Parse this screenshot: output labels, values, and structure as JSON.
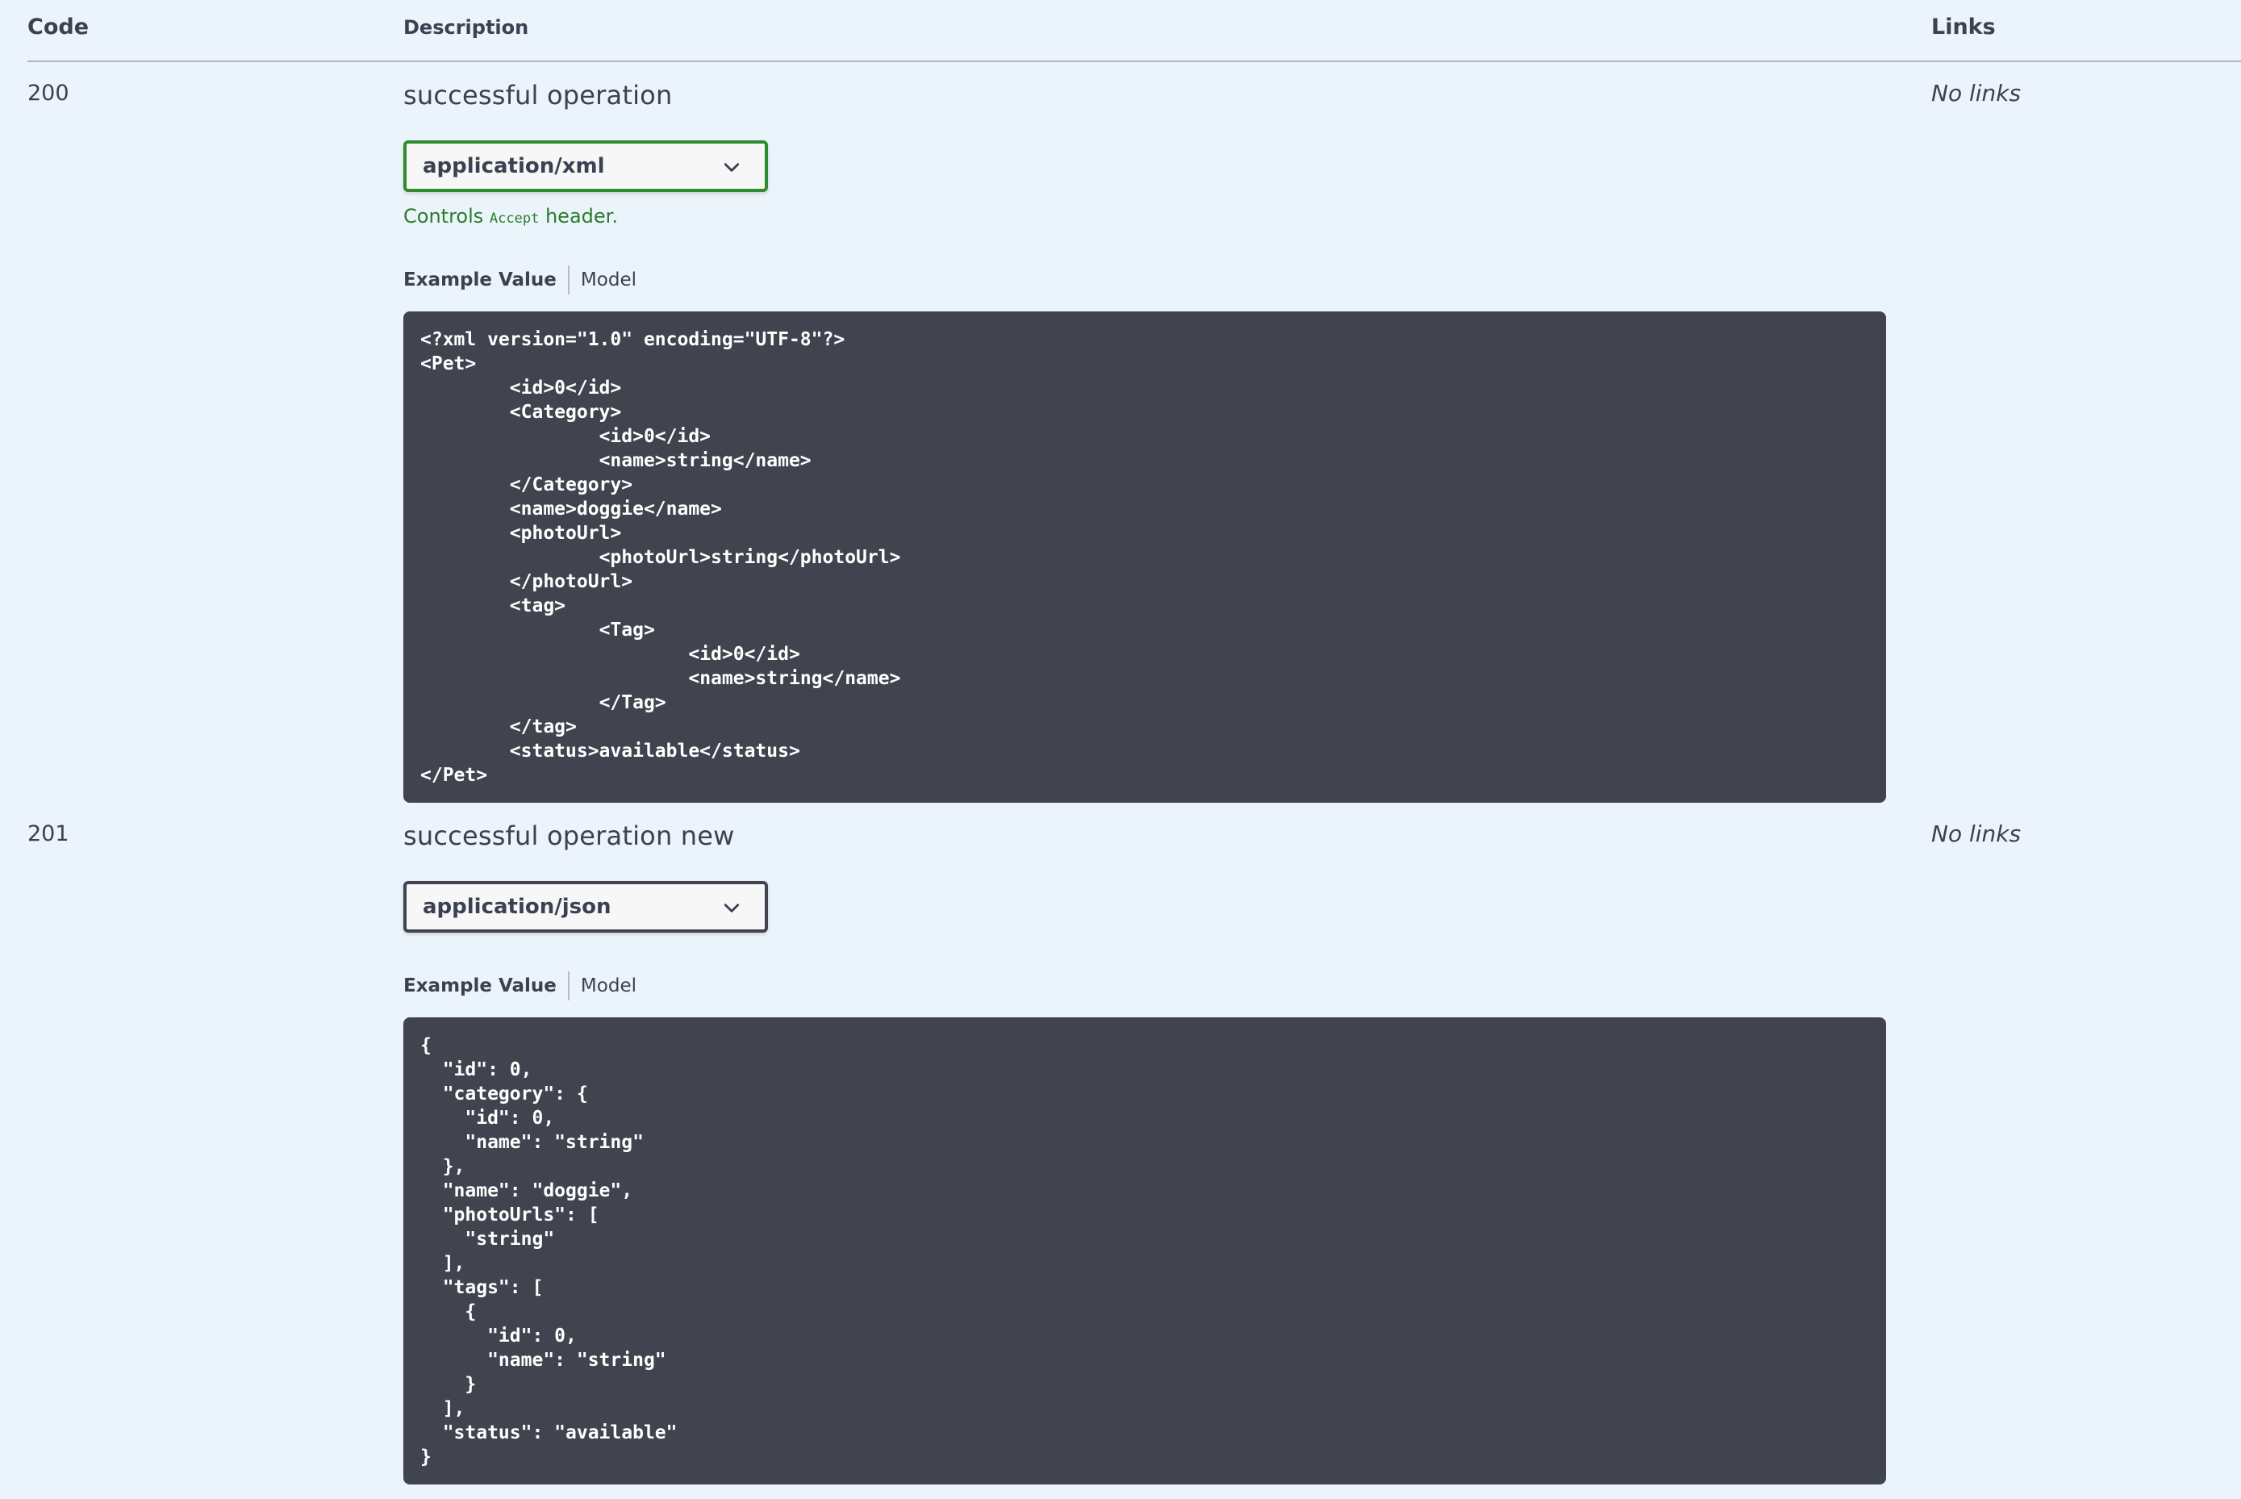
{
  "header": {
    "code": "Code",
    "description": "Description",
    "links": "Links"
  },
  "responses": [
    {
      "code": "200",
      "description": "successful operation",
      "links": "No links",
      "media_type": "application/xml",
      "controls_prefix": "Controls",
      "controls_code": "Accept",
      "controls_suffix": "header.",
      "tab_example": "Example Value",
      "tab_model": "Model",
      "example": "<?xml version=\"1.0\" encoding=\"UTF-8\"?>\n<Pet>\n\t<id>0</id>\n\t<Category>\n\t\t<id>0</id>\n\t\t<name>string</name>\n\t</Category>\n\t<name>doggie</name>\n\t<photoUrl>\n\t\t<photoUrl>string</photoUrl>\n\t</photoUrl>\n\t<tag>\n\t\t<Tag>\n\t\t\t<id>0</id>\n\t\t\t<name>string</name>\n\t\t</Tag>\n\t</tag>\n\t<status>available</status>\n</Pet>"
    },
    {
      "code": "201",
      "description": "successful operation new",
      "links": "No links",
      "media_type": "application/json",
      "tab_example": "Example Value",
      "tab_model": "Model",
      "example": "{\n  \"id\": 0,\n  \"category\": {\n    \"id\": 0,\n    \"name\": \"string\"\n  },\n  \"name\": \"doggie\",\n  \"photoUrls\": [\n    \"string\"\n  ],\n  \"tags\": [\n    {\n      \"id\": 0,\n      \"name\": \"string\"\n    }\n  ],\n  \"status\": \"available\"\n}"
    }
  ],
  "icons": {
    "dropdown": "chevron-down-icon"
  },
  "colors": {
    "background": "#ebf3fb",
    "code_block": "#41444e",
    "selected_border": "#2e8b2e",
    "hint_text": "#2b7d2b"
  }
}
